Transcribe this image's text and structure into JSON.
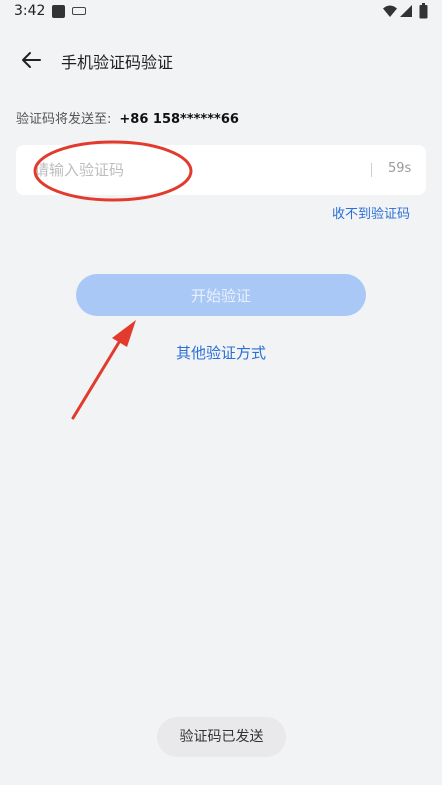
{
  "status_bar": {
    "time": "3:42"
  },
  "header": {
    "title": "手机验证码验证"
  },
  "send_info": {
    "label": "验证码将发送至:",
    "phone": "+86 158******66"
  },
  "code_input": {
    "placeholder": "请输入验证码",
    "value": "",
    "countdown": "59s"
  },
  "links": {
    "no_code": "收不到验证码",
    "other_methods": "其他验证方式"
  },
  "start_button": {
    "label": "开始验证"
  },
  "toast": {
    "message": "验证码已发送"
  },
  "colors": {
    "background": "#f2f3f5",
    "link": "#2a6fd6",
    "button_disabled": "#a9c8f6",
    "annotation": "#e23b2e"
  },
  "icons": {
    "back": "arrow-left-icon",
    "wifi": "wifi-icon",
    "signal": "signal-icon",
    "battery": "battery-icon"
  }
}
